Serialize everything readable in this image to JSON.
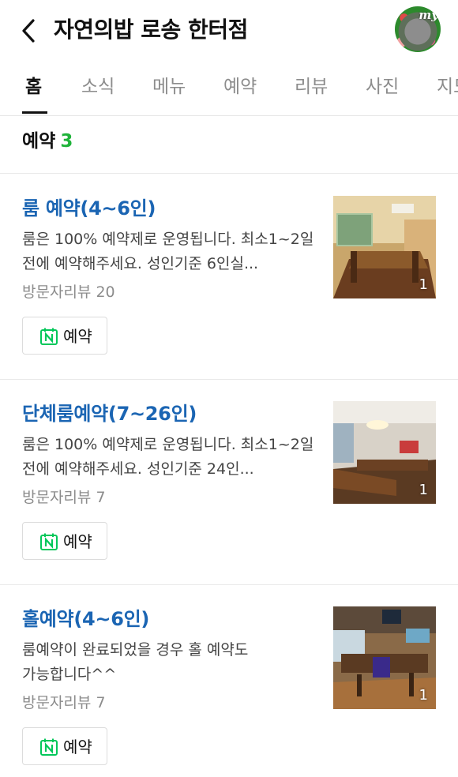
{
  "header": {
    "title": "자연의밥 로송 한터점",
    "avatar_text": "my"
  },
  "tabs": [
    {
      "label": "홈",
      "active": true
    },
    {
      "label": "소식"
    },
    {
      "label": "메뉴"
    },
    {
      "label": "예약"
    },
    {
      "label": "리뷰"
    },
    {
      "label": "사진"
    },
    {
      "label": "지도"
    }
  ],
  "section": {
    "title": "예약",
    "count": "3"
  },
  "items": [
    {
      "name": "룸 예약(4~6인)",
      "desc": "룸은 100% 예약제로 운영됩니다. 최소1~2일 전에 예약해주세요. 성인기준 6인실...",
      "review": "방문자리뷰 20",
      "button": "예약",
      "photo_count": "1"
    },
    {
      "name": "단체룸예약(7~26인)",
      "desc": "룸은 100% 예약제로 운영됩니다. 최소1~2일 전에 예약해주세요. 성인기준 24인...",
      "review": "방문자리뷰 7",
      "button": "예약",
      "photo_count": "1"
    },
    {
      "name": "홀예약(4~6인)",
      "desc": "룸예약이 완료되었을 경우 홀 예약도 가능합니다^^",
      "review": "방문자리뷰 7",
      "button": "예약",
      "photo_count": "1"
    }
  ],
  "colors": {
    "accent_green": "#1fb33a",
    "link_blue": "#1b65b3",
    "naver_green": "#03c75a"
  }
}
